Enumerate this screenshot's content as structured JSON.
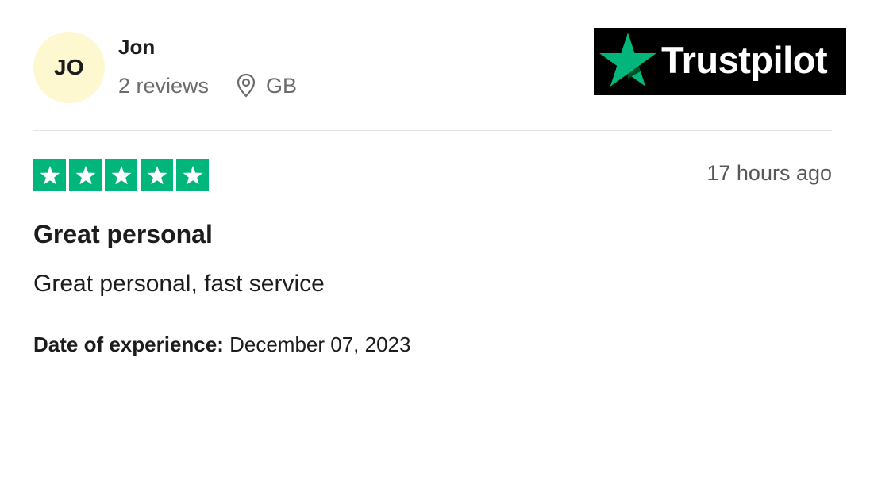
{
  "reviewer": {
    "initials": "JO",
    "name": "Jon",
    "reviews_count": "2 reviews",
    "country": "GB",
    "avatar_color": "#fdf8cf"
  },
  "logo": {
    "text": "Trustpilot",
    "icon": "trustpilot-star-icon"
  },
  "review": {
    "rating": 5,
    "max_rating": 5,
    "rating_color": "#00b67a",
    "time_ago": "17 hours ago",
    "title": "Great personal",
    "body": "Great personal, fast service",
    "experience_label": "Date of experience:",
    "experience_date": "December 07, 2023"
  }
}
